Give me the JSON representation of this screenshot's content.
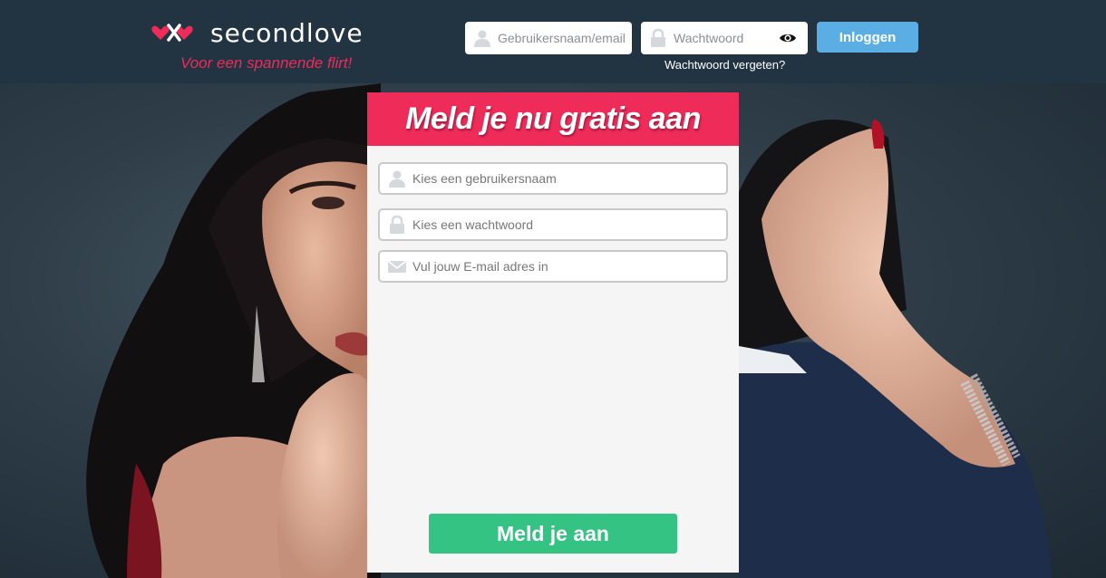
{
  "header": {
    "logo_text": "secondlove",
    "tagline": "Voor een spannende flirt!",
    "login": {
      "username_placeholder": "Gebruikersnaam/email",
      "password_placeholder": "Wachtwoord",
      "login_label": "Inloggen",
      "forgot_password": "Wachtwoord vergeten?"
    }
  },
  "signup": {
    "title": "Meld je nu gratis aan",
    "username_placeholder": "Kies een gebruikersnaam",
    "password_placeholder": "Kies een wachtwoord",
    "email_placeholder": "Vul jouw E-mail adres in",
    "submit_label": "Meld je aan"
  },
  "colors": {
    "header_bg": "#223342",
    "brand_pink": "#ee2b59",
    "login_blue": "#5aaee3",
    "submit_green": "#35c384"
  },
  "icons": {
    "logo": "hearts-logo-icon",
    "user": "user-icon",
    "lock": "lock-icon",
    "email": "envelope-icon",
    "show_password": "eye-icon"
  }
}
